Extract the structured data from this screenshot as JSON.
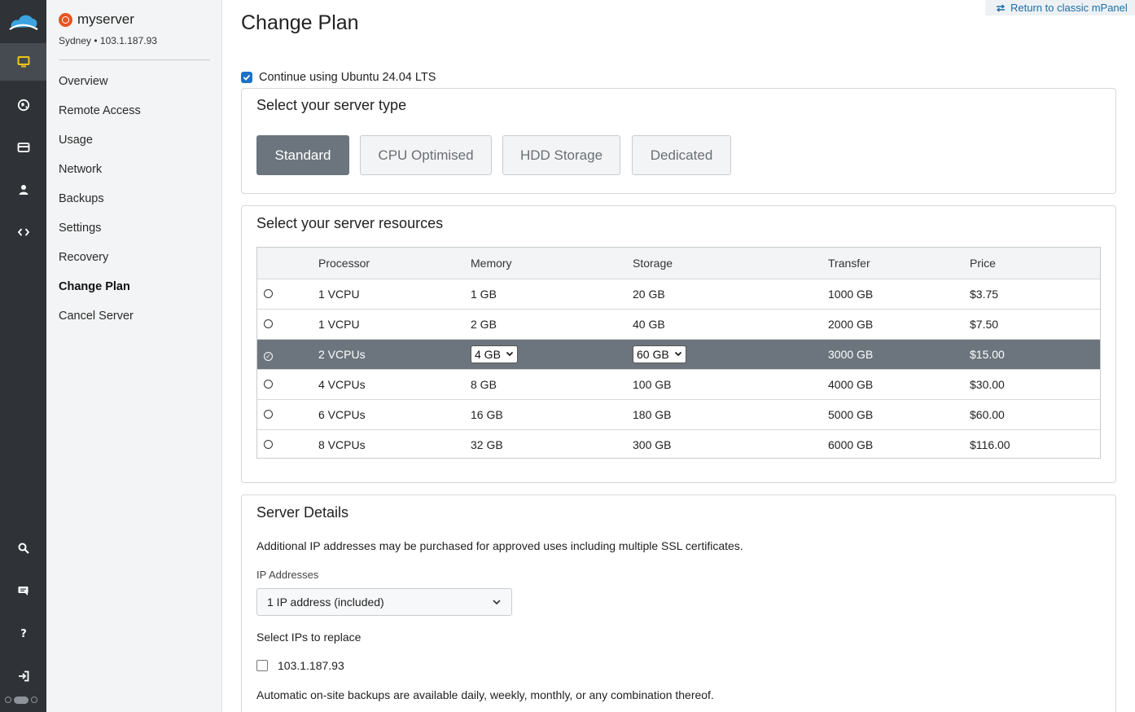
{
  "top_link": {
    "label": "Return to classic mPanel"
  },
  "server": {
    "name": "myserver",
    "location": "Sydney • 103.1.187.93"
  },
  "nav": {
    "items": [
      {
        "label": "Overview"
      },
      {
        "label": "Remote Access"
      },
      {
        "label": "Usage"
      },
      {
        "label": "Network"
      },
      {
        "label": "Backups"
      },
      {
        "label": "Settings"
      },
      {
        "label": "Recovery"
      },
      {
        "label": "Change Plan",
        "active": true
      },
      {
        "label": "Cancel Server"
      }
    ]
  },
  "rail_icons": [
    "cloud-logo-icon",
    "monitor-icon",
    "globe-icon",
    "card-icon",
    "user-icon",
    "code-icon",
    "search-icon",
    "chat-icon",
    "help-icon",
    "logout-icon"
  ],
  "page": {
    "title": "Change Plan",
    "continue_label": "Continue using Ubuntu 24.04 LTS",
    "continue_checked": true
  },
  "server_type": {
    "title": "Select your server type",
    "options": [
      "Standard",
      "CPU Optimised",
      "HDD Storage",
      "Dedicated"
    ],
    "selected": "Standard"
  },
  "resources": {
    "title": "Select your server resources",
    "headers": [
      "Processor",
      "Memory",
      "Storage",
      "Transfer",
      "Price"
    ],
    "rows": [
      {
        "processor": "1 VCPU",
        "memory": "1 GB",
        "storage": "20 GB",
        "transfer": "1000 GB",
        "price": "$3.75"
      },
      {
        "processor": "1 VCPU",
        "memory": "2 GB",
        "storage": "40 GB",
        "transfer": "2000 GB",
        "price": "$7.50"
      },
      {
        "processor": "2 VCPUs",
        "memory": "4 GB",
        "storage": "60 GB",
        "transfer": "3000 GB",
        "price": "$15.00",
        "selected": true
      },
      {
        "processor": "4 VCPUs",
        "memory": "8 GB",
        "storage": "100 GB",
        "transfer": "4000 GB",
        "price": "$30.00"
      },
      {
        "processor": "6 VCPUs",
        "memory": "16 GB",
        "storage": "180 GB",
        "transfer": "5000 GB",
        "price": "$60.00"
      },
      {
        "processor": "8 VCPUs",
        "memory": "32 GB",
        "storage": "300 GB",
        "transfer": "6000 GB",
        "price": "$116.00"
      }
    ]
  },
  "details": {
    "title": "Server Details",
    "ip_note": "Additional IP addresses may be purchased for approved uses including multiple SSL certificates.",
    "ip_label": "IP Addresses",
    "ip_value": "1 IP address (included)",
    "replace_label": "Select IPs to replace",
    "replace_ip": "103.1.187.93",
    "backup_note": "Automatic on-site backups are available daily, weekly, monthly, or any combination thereof."
  },
  "colors": {
    "rail": "#2f3338",
    "accent": "#1a73c8",
    "selected_row": "#6c757d",
    "ubuntu": "#e95420",
    "active_icon": "#f0c419"
  }
}
